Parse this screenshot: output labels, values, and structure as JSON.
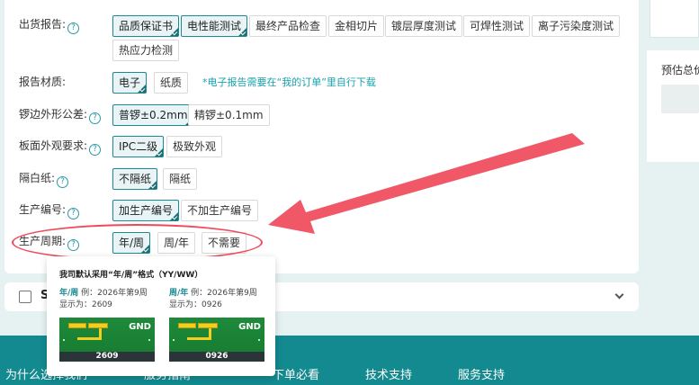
{
  "form": {
    "rows": [
      {
        "label": "出货报告:",
        "options": [
          {
            "text": "品质保证书",
            "selected": true
          },
          {
            "text": "电性能测试",
            "selected": true
          },
          {
            "text": "最终产品检查",
            "selected": false
          },
          {
            "text": "金相切片",
            "selected": false
          },
          {
            "text": "镀层厚度测试",
            "selected": false
          },
          {
            "text": "可焊性测试",
            "selected": false
          },
          {
            "text": "离子污染度测试",
            "selected": false
          },
          {
            "text": "热应力检测",
            "selected": false
          }
        ]
      },
      {
        "label": "报告材质:",
        "options": [
          {
            "text": "电子",
            "selected": true
          },
          {
            "text": "纸质",
            "selected": false
          }
        ],
        "note": "*电子报告需要在“我的订单”里自行下载"
      },
      {
        "label": "锣边外形公差:",
        "options": [
          {
            "text": "普锣±0.2mm",
            "selected": true
          },
          {
            "text": "精锣±0.1mm",
            "selected": false
          }
        ]
      },
      {
        "label": "板面外观要求:",
        "options": [
          {
            "text": "IPC二级",
            "selected": true
          },
          {
            "text": "极致外观",
            "selected": false
          }
        ]
      },
      {
        "label": "隔白纸:",
        "options": [
          {
            "text": "不隔纸",
            "selected": true
          },
          {
            "text": "隔纸",
            "selected": false
          }
        ]
      },
      {
        "label": "生产编号:",
        "options": [
          {
            "text": "加生产编号",
            "selected": true
          },
          {
            "text": "不加生产编号",
            "selected": false
          }
        ]
      },
      {
        "label": "生产周期:",
        "options": [
          {
            "text": "年/周",
            "selected": true
          },
          {
            "text": "周/年",
            "selected": false
          },
          {
            "text": "不需要",
            "selected": false
          }
        ]
      }
    ],
    "help_glyph": "?"
  },
  "sidebar": {
    "price_label": "预估总价"
  },
  "collapse": {
    "label": "S"
  },
  "footer": {
    "items": [
      "为什么选择我们",
      "服务指南",
      "下单必看",
      "技术支持",
      "服务支持"
    ]
  },
  "tooltip": {
    "title": "我司默认采用“年/周”格式（YY/WW）",
    "left": {
      "fmt": "年/周",
      "example": "例：2026年第9周",
      "display": "显示为：2609",
      "code": "2609"
    },
    "right": {
      "fmt": "周/年",
      "example": "例：2026年第9周",
      "display": "显示为：0926",
      "code": "0926"
    },
    "gnd": "GND"
  },
  "colors": {
    "accent": "#1c8a93",
    "annotation": "#f04a5a",
    "footer": "#128a8f",
    "note": "#17a2ab"
  }
}
